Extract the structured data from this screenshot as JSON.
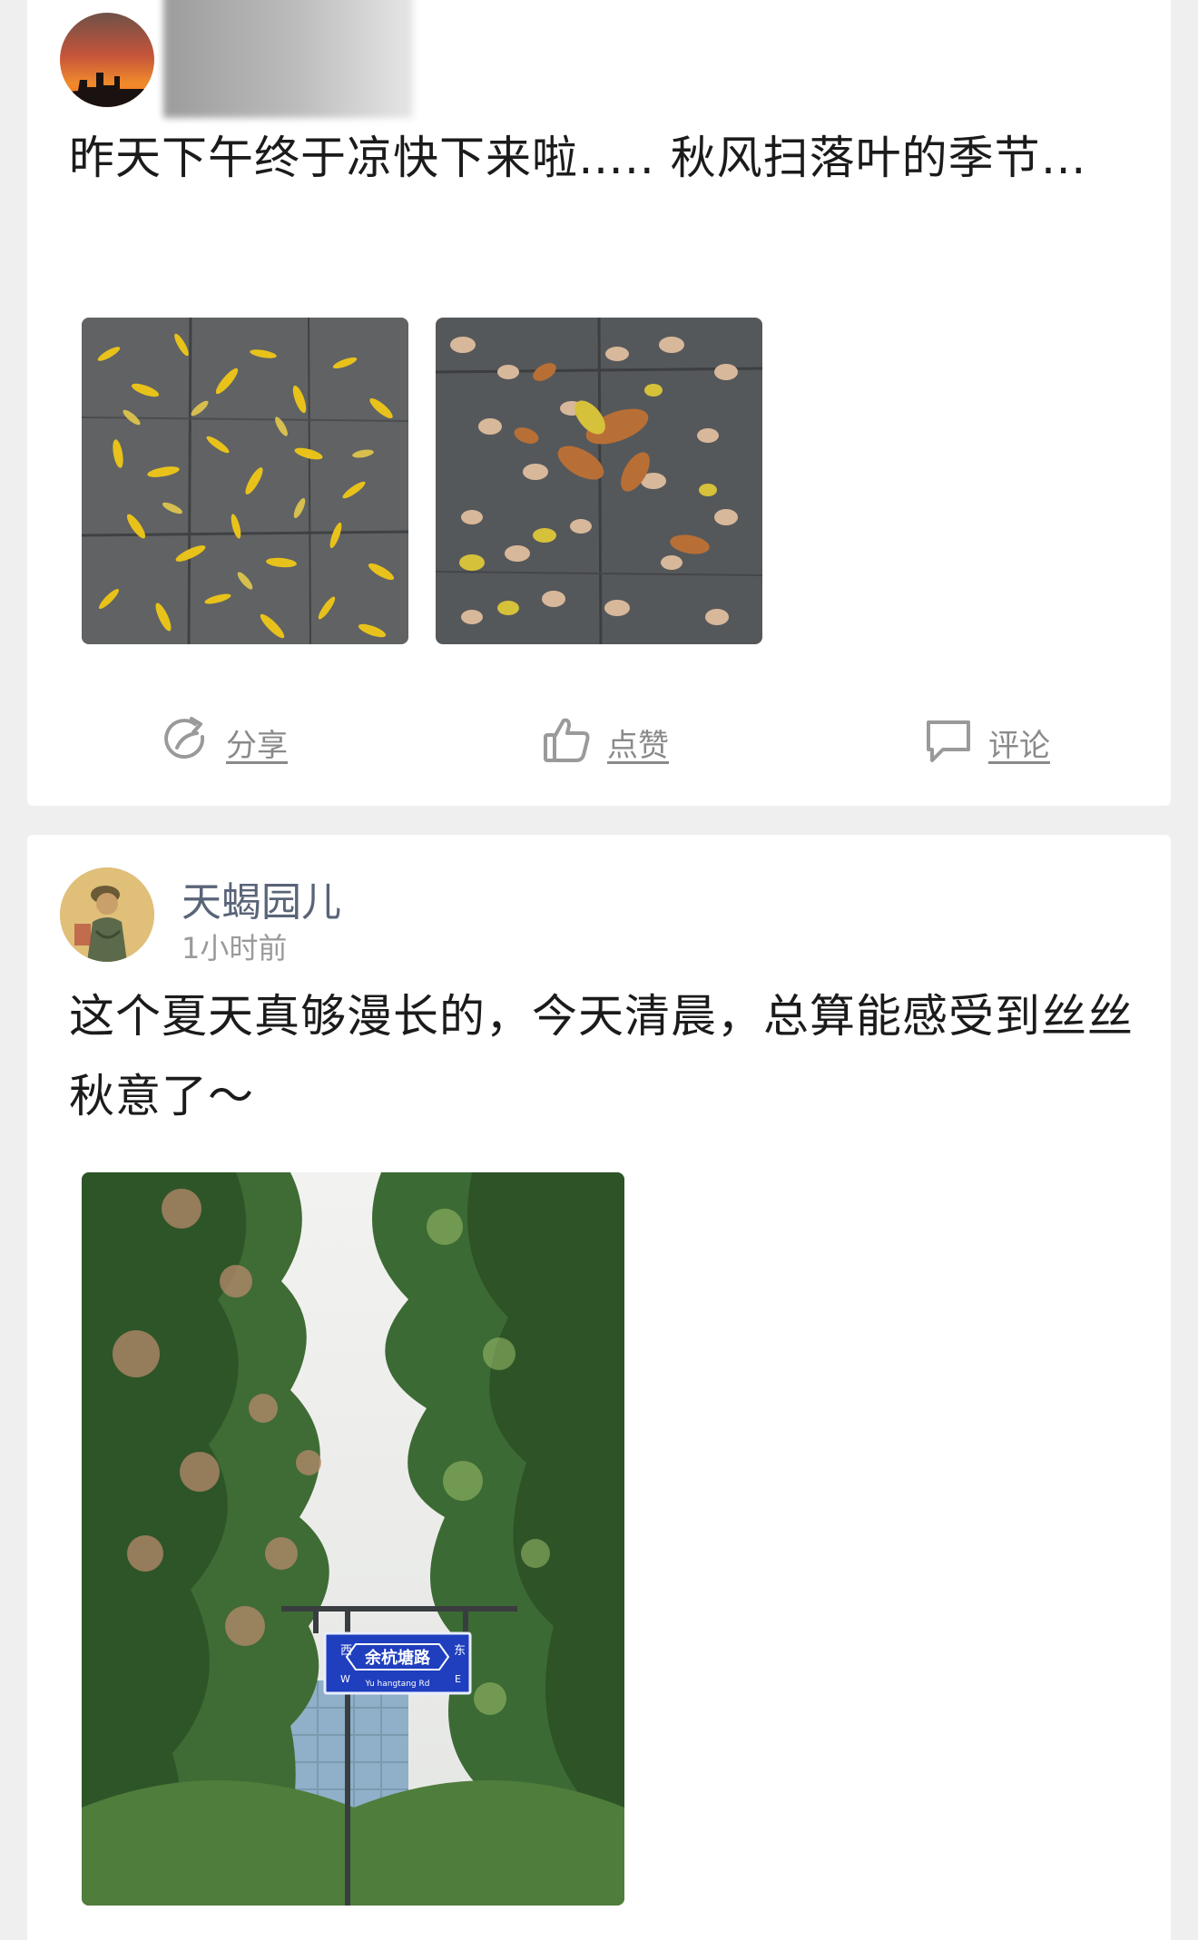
{
  "posts": [
    {
      "author_name_visible": false,
      "text": "昨天下午终于凉快下来啦….. 秋风扫落叶的季节…",
      "images": [
        "yellow-leaves-photo",
        "brown-leaves-photo"
      ],
      "actions": {
        "share_label": "分享",
        "like_label": "点赞",
        "comment_label": "评论"
      }
    },
    {
      "author": "天蝎园儿",
      "time": "1小时前",
      "text": "这个夏天真够漫长的，今天清晨，总算能感受到丝丝秋意了～",
      "images": [
        "street-trees-photo"
      ],
      "sign": {
        "main": "余杭塘路",
        "pinyin": "Yu hangtang Rd",
        "west": "西",
        "east": "东",
        "west_letter": "W",
        "east_letter": "E"
      }
    }
  ],
  "icons": {
    "share": "share-icon",
    "like": "thumbs-up-icon",
    "comment": "comment-icon"
  },
  "colors": {
    "background": "#efefef",
    "card": "#ffffff",
    "action_text": "#8a8a8a",
    "username": "#5a6478",
    "sign_blue": "#1f3fbf"
  }
}
